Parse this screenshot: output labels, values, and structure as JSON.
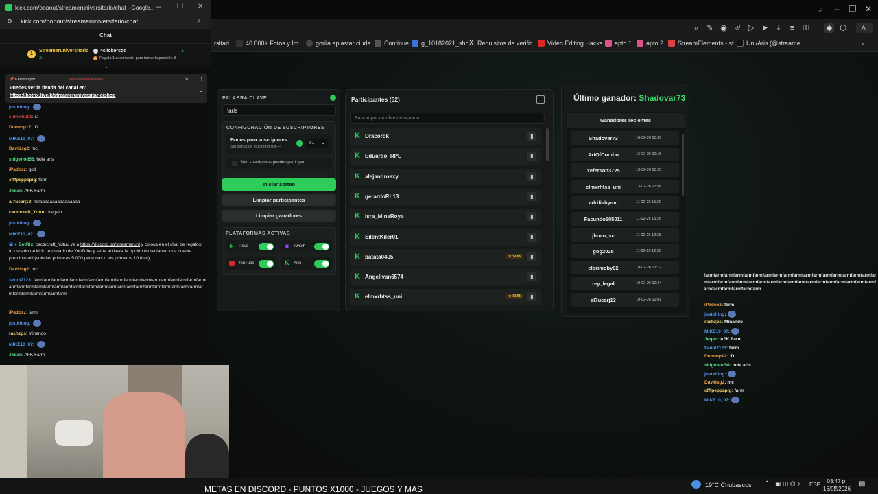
{
  "browser": {
    "bookmarks": [
      "rsitari...",
      "40.000+ Fotos y Im...",
      "gorila aplastar ciuda...",
      "Continue",
      "g_10182021_shcc",
      "Requisitos de verific...",
      "Video Editing Hacks...",
      "apto 1",
      "apto 2",
      "StreamElements - st...",
      "Uni/Aris (@streame..."
    ]
  },
  "app": {
    "keyword": {
      "title": "PALABRA CLAVE",
      "value": "!aris"
    },
    "subs": {
      "title": "CONFIGURACIÓN DE SUSCRIPTORES",
      "bonus_label": "Bonus para suscriptores",
      "bonus_sub": "Sin bonus de suscriptor (OFF)",
      "multiplier": "x1",
      "only_subs": "Solo suscriptores pueden participar"
    },
    "buttons": {
      "start": "Iniciar sorteo",
      "clear_participants": "Limpiar participantes",
      "clear_winners": "Limpiar ganadores"
    },
    "platforms": {
      "title": "PLATAFORMAS ACTIVAS",
      "trovo": "Trovo",
      "twitch": "Twitch",
      "youtube": "YouTube",
      "kick": "Kick"
    },
    "participants": {
      "title": "Participantes (52)",
      "search_placeholder": "Buscar por nombre de usuario...",
      "items": [
        {
          "name": "Dracordk",
          "sub": ""
        },
        {
          "name": "Eduardo_RPL",
          "sub": ""
        },
        {
          "name": "alejandrosxy",
          "sub": ""
        },
        {
          "name": "gerardoRL13",
          "sub": ""
        },
        {
          "name": "Isra_MineRoya",
          "sub": ""
        },
        {
          "name": "SilentKiler01",
          "sub": ""
        },
        {
          "name": "patata0405",
          "sub": "★ SUB"
        },
        {
          "name": "Angelivan6574",
          "sub": ""
        },
        {
          "name": "elmxrhtss_uni",
          "sub": "★ SUB"
        }
      ]
    },
    "winner": {
      "label": "Último ganador:",
      "name": "Shadovar73",
      "recent_title": "Ganadores recientes",
      "recent": [
        {
          "name": "Shadovar73",
          "date": "16-02-26 15:36"
        },
        {
          "name": "ArtOfCombo",
          "date": "16-02-26 12:15"
        },
        {
          "name": "Yeferson3725",
          "date": "13-02-26 15:20"
        },
        {
          "name": "elmxrhtss_uni",
          "date": "13-02-26 13:36"
        },
        {
          "name": "adrifishymc",
          "date": "11-02-26 15:30"
        },
        {
          "name": "Facundo505011",
          "date": "11-02-26 15:26"
        },
        {
          "name": "jhoan_sc",
          "date": "11-02-26 12:38"
        },
        {
          "name": "gog2025",
          "date": "11-02-26 12:35"
        },
        {
          "name": "elprimoby02",
          "date": "10-02-26 17:12"
        },
        {
          "name": "rey_legal",
          "date": "10-02-26 12:44"
        },
        {
          "name": "al7ucarj13",
          "date": "10-02-26 12:41"
        }
      ]
    }
  },
  "chat": {
    "window_title": "kick.com/popout/streameruniversitario/chat - Google...",
    "url": "kick.com/popout/streameruniversitario/chat",
    "header": "Chat",
    "goal": {
      "rank": "1",
      "streamer": "Streameruniversitario",
      "streamer_count": "2",
      "user": "4clickersqq",
      "user_count": "1",
      "rule": "Regala 1 suscripción para tomar la posición 3"
    },
    "pinned": {
      "by_label": "Enviado por",
      "by_user": "Streameruniversitario",
      "text": "Puedes ver la tienda del canal en:",
      "link": "https://botrix.live/k/streameruniversitario/shop"
    },
    "messages": [
      {
        "user": "justkhing",
        "color": "#5b8def",
        "text": ""
      },
      {
        "user": "slimemii01",
        "color": "#e04343",
        "text": "c:"
      },
      {
        "user": "Dunnop12",
        "color": "#f0a24a",
        "text": ":D"
      },
      {
        "user": "MIKE10_07",
        "color": "#4a9cf0",
        "text": ""
      },
      {
        "user": "Davidsg2",
        "color": "#f0a24a",
        "text": "mc"
      },
      {
        "user": "shigenod56",
        "color": "#5ee08a",
        "text": "hola aris"
      },
      {
        "user": "iPadoxz",
        "color": "#f0a24a",
        "text": "god"
      },
      {
        "user": "cfffpeppapig",
        "color": "#f5d76e",
        "text": "farm"
      },
      {
        "user": "Jeqan",
        "color": "#5ee08a",
        "text": "AFK Farm"
      },
      {
        "user": "al7ucarj13",
        "color": "#f5d76e",
        "text": "holaaaaaaaaaaaaaaaa"
      },
      {
        "user": "cactucraft_Yutuu",
        "color": "#f5d76e",
        "text": "Iregalo"
      },
      {
        "user": "justkhing",
        "color": "#5b8def",
        "text": ""
      },
      {
        "user": "MIKE10_07",
        "color": "#4a9cf0",
        "text": ""
      }
    ],
    "botrix": {
      "user": "BotRix",
      "text1": "cactucraft_Yutuu ve a",
      "link": "https://discord.gg/streameruni",
      "text2": "y coloca en el chat de regalos: tu usuario de kick, tu usuario de YouTube y se te activara la opción de reclamar una cuenta premium alli (solo las primeras 5.000 personas o los primeros 10 dias)"
    },
    "messages2": [
      {
        "user": "Davidsg2",
        "color": "#f0a24a",
        "text": "mc"
      },
      {
        "user": "faviol2123",
        "color": "#4a9cf0",
        "text": "farmfarmfarmfarmfarmfarmfarmfarmfarmfarmfarmfarmfarmfarmfarmfarmfarmfarmfarmfarmfarmfarmfarmfarmfarmfarmfarmfarmfarmfarmfarmfarmfarmfarmfarmfarmfarmfarmfarmfarmfarmfarmfarmfarmfarmfarmfarm"
      },
      {
        "user": "iPadoxz",
        "color": "#f0a24a",
        "text": "farm"
      },
      {
        "user": "justkhing",
        "color": "#5b8def",
        "text": ""
      },
      {
        "user": "rachzps",
        "color": "#f5d76e",
        "text": "Minando"
      },
      {
        "user": "MIKE10_07",
        "color": "#4a9cf0",
        "text": ""
      },
      {
        "user": "Jeqan",
        "color": "#5ee08a",
        "text": "AFK Farm"
      }
    ]
  },
  "overlay_chat": {
    "farm_block": "farmfarmfarmfarmfarmfarmfarmfarmfarmfarmfarmfarmfarmfarmfarmfarmfarmfarmfarmfarmfarmfarmfarmfarmfarmfarmfarmfarmfarmfarmfarmfarmfarmfarmfarmfarmfarmfarmfarmfarmfarm",
    "lines": [
      {
        "user": "iPadoxz",
        "color": "#f0a24a",
        "text": ": farm"
      },
      {
        "user": "justkhing",
        "color": "#5b8def",
        "text": ":"
      },
      {
        "user": "rachzps",
        "color": "#f5d76e",
        "text": ": Minando"
      },
      {
        "user": "MIKE10_07",
        "color": "#4a9cf0",
        "text": ":"
      },
      {
        "user": "Jeqan",
        "color": "#5ee08a",
        "text": ": AFK Farm"
      },
      {
        "user": "faviol2123",
        "color": "#4a9cf0",
        "text": ": farm"
      },
      {
        "user": "Dunnop12",
        "color": "#f0a24a",
        "text": ": :D"
      },
      {
        "user": "shigenod56",
        "color": "#5ee08a",
        "text": ": hola aris"
      },
      {
        "user": "justkhing",
        "color": "#5b8def",
        "text": ":"
      },
      {
        "user": "Davidsg2",
        "color": "#f0a24a",
        "text": ": mc"
      },
      {
        "user": "cfffpeppapig",
        "color": "#f5d76e",
        "text": ": farm"
      },
      {
        "user": "MIKE10_07",
        "color": "#4a9cf0",
        "text": ":"
      }
    ]
  },
  "taskbar": {
    "ticker": "METAS EN DISCORD - PUNTOS X1000 - JUEGOS Y MAS",
    "weather": "19°C  Chubascos",
    "lang": "ESP",
    "time": "03:47 p. m.",
    "date": "16/02/2026"
  }
}
